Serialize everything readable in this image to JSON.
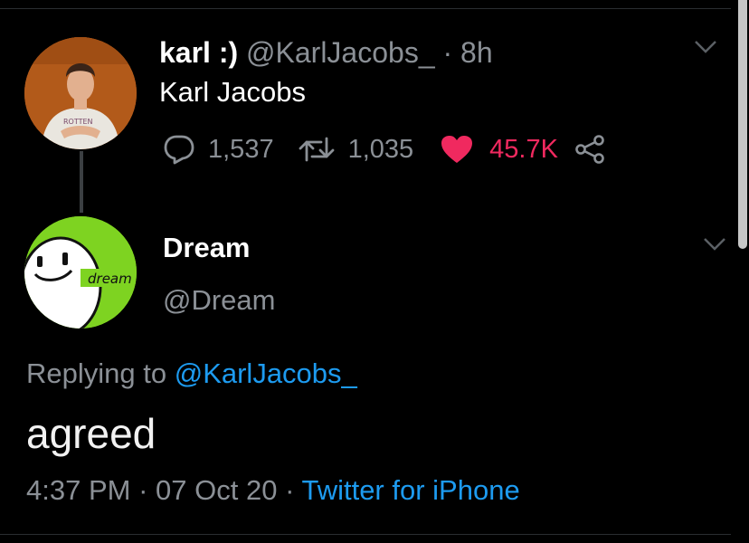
{
  "parent_tweet": {
    "display_name": "karl :)",
    "handle": "@KarlJacobs_",
    "separator": "·",
    "time_ago": "8h",
    "text": "Karl Jacobs",
    "stats": {
      "replies": "1,537",
      "retweets": "1,035",
      "likes": "45.7K"
    },
    "avatar_shirt_text": "ROTTEN"
  },
  "reply_tweet": {
    "display_name": "Dream",
    "handle": "@Dream",
    "replying_prefix": "Replying to",
    "replying_to": "@KarlJacobs_",
    "text": "agreed",
    "time": "4:37 PM",
    "separator": "·",
    "date": "07 Oct 20",
    "separator2": "·",
    "client": "Twitter for iPhone",
    "avatar_label": "dream"
  },
  "colors": {
    "background": "#000000",
    "like": "#f0295f",
    "link": "#1d9bf0",
    "muted": "#8b9096",
    "dream_avatar": "#7ed321"
  },
  "icons": [
    "reply-icon",
    "retweet-icon",
    "heart-icon",
    "share-icon",
    "chevron-down-icon"
  ]
}
